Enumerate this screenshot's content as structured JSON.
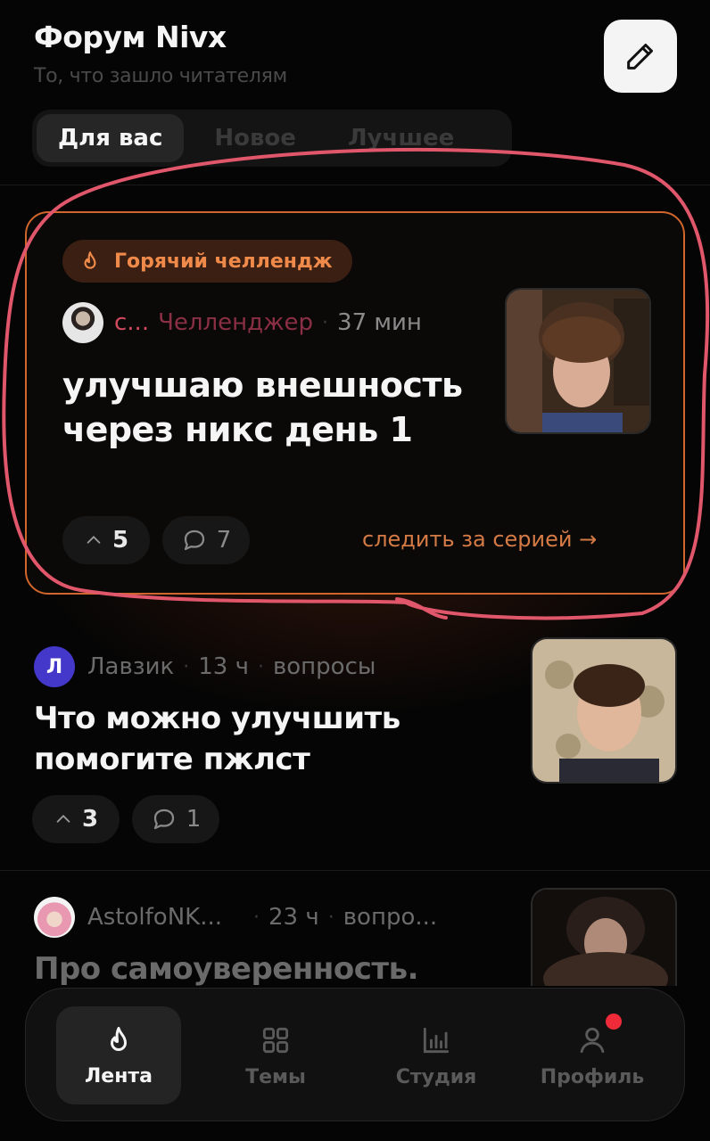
{
  "header": {
    "title": "Форум Nivx",
    "subtitle": "То, что зашло читателям"
  },
  "tabs": [
    {
      "label": "Для вас",
      "active": true
    },
    {
      "label": "Новое",
      "active": false
    },
    {
      "label": "Лучшее",
      "active": false
    }
  ],
  "hot_post": {
    "badge": "Горячий челлендж",
    "author": "с...",
    "role": "Челленджер",
    "time": "37 мин",
    "title": "улучшаю внешность через никс день 1",
    "upvotes": "5",
    "comments": "7",
    "follow_label": "следить за серией →"
  },
  "posts": [
    {
      "avatar_letter": "Л",
      "author": "Лавзик",
      "time": "13 ч",
      "category": "вопросы",
      "title": "Что можно улучшить помогите пжлст",
      "upvotes": "3",
      "comments": "1"
    },
    {
      "author": "AstolfoNK...",
      "time": "23 ч",
      "category": "вопро...",
      "title": "Про самоуверенность."
    }
  ],
  "nav": [
    {
      "label": "Лента",
      "icon": "flame-icon",
      "active": true
    },
    {
      "label": "Темы",
      "icon": "grid-icon",
      "active": false
    },
    {
      "label": "Студия",
      "icon": "bar-chart-icon",
      "active": false
    },
    {
      "label": "Профиль",
      "icon": "user-icon",
      "active": false,
      "notification": true
    }
  ],
  "colors": {
    "accent": "#d0662b",
    "annotation_circle": "#e0566a",
    "notification": "#ef2b3a"
  }
}
